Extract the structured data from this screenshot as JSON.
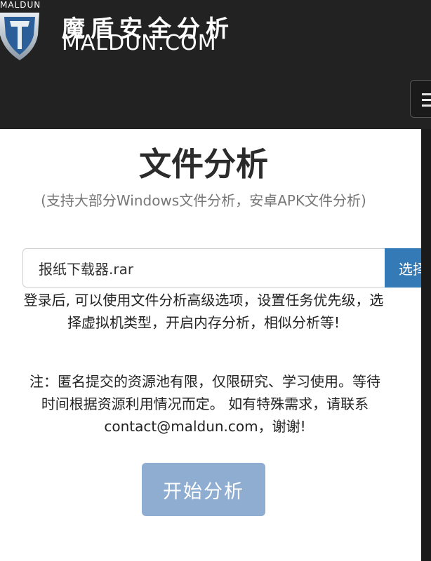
{
  "header": {
    "logo_text": "MALDUN",
    "brand_cn": "魔盾安全分析",
    "brand_en": "MALDUN.COM",
    "menu_icon": "hamburger-menu-icon"
  },
  "main": {
    "title": "文件分析",
    "subtitle": "(支持大部分Windows文件分析，安卓APK文件分析)",
    "file_input": {
      "value": "报纸下载器.rar"
    },
    "choose_button_label": "选择",
    "login_hint": "登录后, 可以使用文件分析高级选项，设置任务优先级，选择虚拟机类型，开启内存分析，相似分析等!",
    "note": "注：匿名提交的资源池有限，仅限研究、学习使用。等待时间根据资源利用情况而定。 如有特殊需求，请联系contact@maldun.com，谢谢!",
    "start_button_label": "开始分析"
  },
  "colors": {
    "header_bg": "#222222",
    "primary": "#337ab7",
    "primary_disabled": "#8eadd0"
  }
}
